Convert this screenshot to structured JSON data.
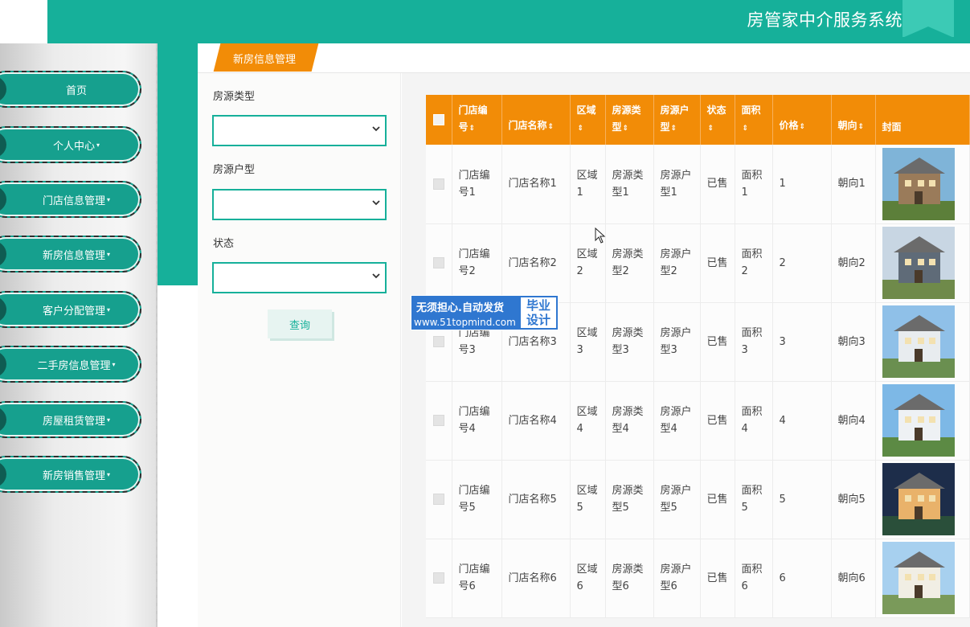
{
  "header": {
    "title": "房管家中介服务系统"
  },
  "sidebar": {
    "items": [
      {
        "label": "首页",
        "caret": ""
      },
      {
        "label": "个人中心",
        "caret": "▾"
      },
      {
        "label": "门店信息管理",
        "caret": "▾"
      },
      {
        "label": "新房信息管理",
        "caret": "▾"
      },
      {
        "label": "客户分配管理",
        "caret": "▾"
      },
      {
        "label": "二手房信息管理",
        "caret": "▾"
      },
      {
        "label": "房屋租赁管理",
        "caret": "▾"
      },
      {
        "label": "新房销售管理",
        "caret": "▾"
      }
    ]
  },
  "tab": {
    "label": "新房信息管理"
  },
  "filter": {
    "type_label": "房源类型",
    "type_value": "",
    "layout_label": "房源户型",
    "layout_value": "",
    "status_label": "状态",
    "status_value": "",
    "query_label": "查询"
  },
  "table": {
    "headers": [
      "门店编号",
      "门店名称",
      "区域",
      "房源类型",
      "房源户型",
      "状态",
      "面积",
      "价格",
      "朝向",
      "封面"
    ],
    "sort_icon": "⇕",
    "rows": [
      {
        "store_no": "门店编号1",
        "store_name": "门店名称1",
        "area": "区域1",
        "type": "房源类型1",
        "layout": "房源户型1",
        "status": "已售",
        "size": "面积1",
        "price": "1",
        "orientation": "朝向1"
      },
      {
        "store_no": "门店编号2",
        "store_name": "门店名称2",
        "area": "区域2",
        "type": "房源类型2",
        "layout": "房源户型2",
        "status": "已售",
        "size": "面积2",
        "price": "2",
        "orientation": "朝向2"
      },
      {
        "store_no": "门店编号3",
        "store_name": "门店名称3",
        "area": "区域3",
        "type": "房源类型3",
        "layout": "房源户型3",
        "status": "已售",
        "size": "面积3",
        "price": "3",
        "orientation": "朝向3"
      },
      {
        "store_no": "门店编号4",
        "store_name": "门店名称4",
        "area": "区域4",
        "type": "房源类型4",
        "layout": "房源户型4",
        "status": "已售",
        "size": "面积4",
        "price": "4",
        "orientation": "朝向4"
      },
      {
        "store_no": "门店编号5",
        "store_name": "门店名称5",
        "area": "区域5",
        "type": "房源类型5",
        "layout": "房源户型5",
        "status": "已售",
        "size": "面积5",
        "price": "5",
        "orientation": "朝向5"
      },
      {
        "store_no": "门店编号6",
        "store_name": "门店名称6",
        "area": "区域6",
        "type": "房源类型6",
        "layout": "房源户型6",
        "status": "已售",
        "size": "面积6",
        "price": "6",
        "orientation": "朝向6"
      }
    ]
  },
  "watermark": {
    "line1": "无须担心.自动发货",
    "line2": "www.51topmind.com",
    "badge_line1": "毕业",
    "badge_line2": "设计"
  },
  "colors": {
    "teal": "#16b09a",
    "orange": "#f28c07",
    "dark_teal": "#16a08e"
  }
}
